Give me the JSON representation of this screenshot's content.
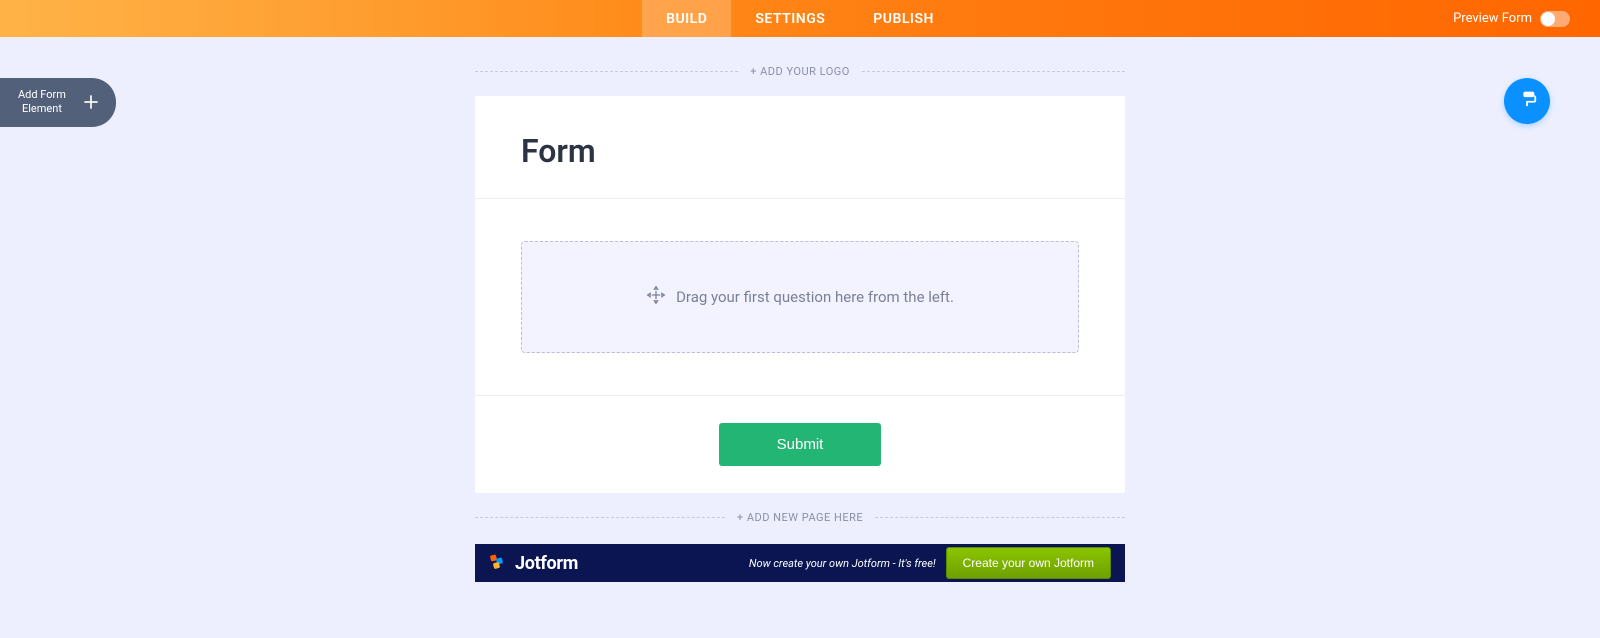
{
  "nav": {
    "tabs": [
      {
        "label": "BUILD",
        "active": true
      },
      {
        "label": "SETTINGS",
        "active": false
      },
      {
        "label": "PUBLISH",
        "active": false
      }
    ],
    "preview_label": "Preview Form"
  },
  "sidebar": {
    "add_element_label": "Add Form\nElement"
  },
  "main": {
    "add_logo_label": "+ ADD YOUR LOGO",
    "form_title": "Form",
    "drop_zone_text": "Drag your first question here from the left.",
    "submit_label": "Submit",
    "add_page_label": "+ ADD NEW PAGE HERE"
  },
  "footer": {
    "brand": "Jotform",
    "promo_text": "Now create your own Jotform - It's free!",
    "cta_label": "Create your own Jotform"
  }
}
